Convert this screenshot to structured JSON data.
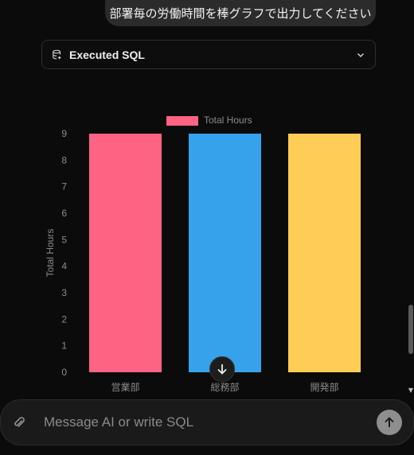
{
  "user_message": "部署毎の労働時間を棒グラフで出力してください",
  "sql_panel": {
    "label": "Executed SQL",
    "icon": "database-icon",
    "expand_icon": "chevron-down-icon"
  },
  "chart_data": {
    "type": "bar",
    "categories": [
      "営業部",
      "総務部",
      "開発部"
    ],
    "series": [
      {
        "name": "Total Hours",
        "values": [
          9,
          9,
          9
        ]
      }
    ],
    "colors": [
      "#ff6384",
      "#36a2eb",
      "#ffcd56"
    ],
    "ylabel": "Total Hours",
    "xlabel": "",
    "ylim": [
      0,
      9
    ],
    "yticks": [
      "0",
      "1",
      "2",
      "3",
      "4",
      "5",
      "6",
      "7",
      "8",
      "9"
    ],
    "legend": "top",
    "grid": false
  },
  "composer": {
    "placeholder": "Message AI or write SQL",
    "attach_icon": "paperclip-icon",
    "send_icon": "arrow-up-icon"
  },
  "scroll_button_icon": "arrow-down-icon"
}
